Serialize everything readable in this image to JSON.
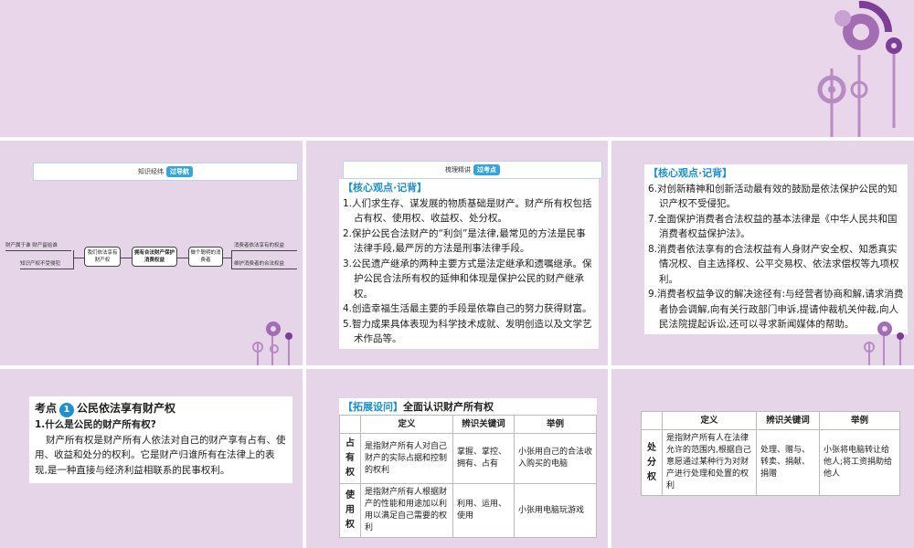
{
  "slides": {
    "s1": {
      "nav_text": "知识经纬",
      "nav_badge": "过导航",
      "map": {
        "left_top": "财产属于谁 财产留给谁",
        "left_bottom": "知识产权不受侵犯",
        "box1": "我们依法享有财产权",
        "box2": "拥有合法财产保护消费权益",
        "box3": "做个聪明的消费者",
        "right_top": "消费者依法享有的权益",
        "right_bottom": "维护消费者的合法权益"
      }
    },
    "s2": {
      "nav_text": "梳理精讲",
      "nav_badge": "过考点",
      "header": "【核心观点·记背】",
      "items": [
        "1.人们求生存、谋发展的物质基础是财产。财产所有权包括占有权、使用权、收益权、处分权。",
        "2.保护公民合法财产的“利剑”是法律,最常见的方法是民事法律手段,最严厉的方法是刑事法律手段。",
        "3.公民遗产继承的两种主要方式是法定继承和遗嘱继承。保护公民合法所有权的延伸和体现是保护公民的财产继承权。",
        "4.创造幸福生活最主要的手段是依靠自己的努力获得财富。",
        "5.智力成果具体表现为科学技术成就、发明创造以及文学艺术作品等。"
      ]
    },
    "s3": {
      "header": "【核心观点·记背】",
      "items": [
        "6.对创新精神和创新活动最有效的鼓励是依法保护公民的知识产权不受侵犯。",
        "7.全面保护消费者合法权益的基本法律是《中华人民共和国消费者权益保护法》。",
        "8.消费者依法享有的合法权益有人身财产安全权、知悉真实情况权、自主选择权、公平交易权、依法求偿权等九项权利。",
        "9.消费者权益争议的解决途径有:与经营者协商和解,请求消费者协会调解,向有关行政部门申诉,提请仲裁机关仲裁,向人民法院提起诉讼,还可以寻求新闻媒体的帮助。"
      ]
    },
    "s4": {
      "kp_label": "考点",
      "kp_num": "1",
      "kp_title": "公民依法享有财产权",
      "question": "1.什么是公民的财产所有权?",
      "answer": "财产所有权是财产所有人依法对自己的财产享有占有、使用、收益和处分的权利。它是财产归谁所有在法律上的表现,是一种直接与经济利益相联系的民事权利。"
    },
    "s5": {
      "header": "【拓展设问】",
      "title": "全面认识财产所有权",
      "columns": [
        "定义",
        "辨识关键词",
        "举例"
      ],
      "rows": [
        {
          "name": "占有权",
          "def": "是指财产所有人对自己财产的实际占据和控制的权利",
          "kw": "掌握、掌控、拥有、占有",
          "ex": "小张用自己的合法收入购买的电脑"
        },
        {
          "name": "使用权",
          "def": "是指财产所有人根据财产的性能和用途加以利用以满足自己需要的权利",
          "kw": "利用、运用、使用",
          "ex": "小张用电脑玩游戏"
        }
      ]
    },
    "s6": {
      "columns": [
        "定义",
        "辨识关键词",
        "举例"
      ],
      "rows": [
        {
          "name": "处分权",
          "def": "是指财产所有人在法律允许的范围内,根据自己意愿通过某种行为对财产进行处理和处置的权利",
          "kw": "处理、赠与、转卖、捐献、捐赠",
          "ex": "小张将电脑转让给他人;将工资捐助给他人"
        }
      ]
    }
  },
  "colors": {
    "accent": "#1e8fcf",
    "slide_bg": "#e6d4e9",
    "banner_bg": "#e9d6ea",
    "deco": "#b98bc4"
  }
}
